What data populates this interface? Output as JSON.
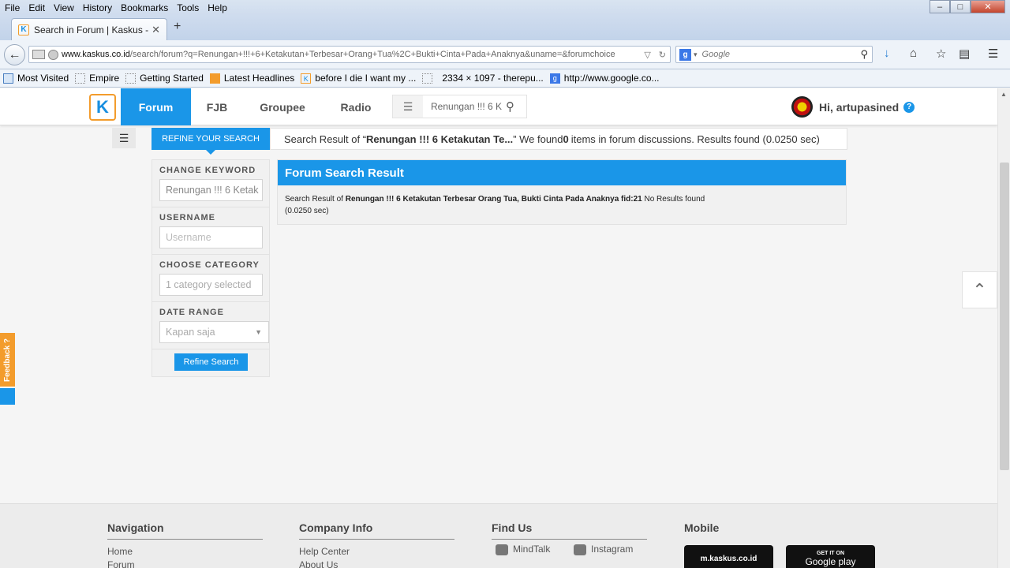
{
  "browser": {
    "menu": [
      "File",
      "Edit",
      "View",
      "History",
      "Bookmarks",
      "Tools",
      "Help"
    ],
    "tab_title": "Search in Forum | Kaskus - ...",
    "url_domain": "www.kaskus.co.id",
    "url_path": "/search/forum?q=Renungan+!!!+6+Ketakutan+Terbesar+Orang+Tua%2C+Bukti+Cinta+Pada+Anaknya&uname=&forumchoice",
    "search_placeholder": "Google",
    "bookmarks": [
      "Most Visited",
      "Empire",
      "Getting Started",
      "Latest Headlines",
      "before I die I want my ...",
      "2334 × 1097 - therepu...",
      "http://www.google.co..."
    ]
  },
  "kaskus": {
    "nav": [
      "Forum",
      "FJB",
      "Groupee",
      "Radio"
    ],
    "search_value": "Renungan !!! 6 K",
    "greeting": "Hi, artupasined",
    "help": "?"
  },
  "search": {
    "refine_tab": "REFINE YOUR SEARCH",
    "info_prefix": "Search Result of “",
    "info_query": "Renungan !!! 6 Ketakutan Te...",
    "info_mid": "” We found ",
    "info_count": "0",
    "info_suffix": " items in forum discussions. Results found (0.0250 sec)"
  },
  "sidebar": {
    "keyword_label": "CHANGE KEYWORD",
    "keyword_value": "Renungan !!! 6 Ketak",
    "username_label": "USERNAME",
    "username_placeholder": "Username",
    "category_label": "CHOOSE CATEGORY",
    "category_value": "1 category selected",
    "date_label": "DATE RANGE",
    "date_value": "Kapan saja",
    "refine_button": "Refine Search"
  },
  "result": {
    "title": "Forum Search Result",
    "prefix": "Search Result of ",
    "query": "Renungan !!! 6 Ketakutan Terbesar Orang Tua, Bukti Cinta Pada Anaknya fid:21",
    "suffix": " No Results found",
    "time": "(0.0250 sec)"
  },
  "feedback": "Feedback ?",
  "footer": {
    "navigation": {
      "title": "Navigation",
      "items": [
        "Home",
        "Forum"
      ]
    },
    "company": {
      "title": "Company Info",
      "items": [
        "Help Center",
        "About Us"
      ]
    },
    "find": {
      "title": "Find Us",
      "items": [
        "MindTalk",
        "Instagram"
      ]
    },
    "mobile": {
      "title": "Mobile",
      "m_label": "m.kaskus.co.id",
      "gp_top": "GET IT ON",
      "gp_label": "Google play"
    }
  }
}
